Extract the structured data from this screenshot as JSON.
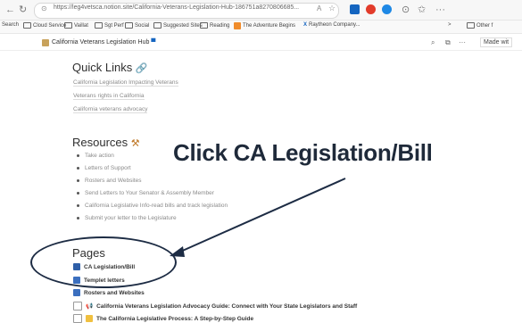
{
  "browser": {
    "url": "https://leg4vetsca.notion.site/California-Veterans-Legislation-Hub-186751a8270806685...",
    "bookmarks": [
      "Search",
      "Cloud Service",
      "Vaillat",
      "Sgt Perf",
      "Social",
      "Suggested Sites",
      "Reading",
      "The Adventure Begins",
      "Raytheon Company...",
      "Other f"
    ],
    "made_with": "Made wit"
  },
  "tab": {
    "title": "California Veterans Legislation Hub"
  },
  "quick_links": {
    "heading": "Quick Links",
    "items": [
      "California Legislation Impacting Veterans",
      "Veterans rights in California",
      "California veterans advocacy"
    ]
  },
  "resources": {
    "heading": "Resources",
    "items": [
      "Take action",
      "Letters of Support",
      "Rosters and Websites",
      "Send Letters to Your Senator & Assembly Member",
      "California Legislative Info-read bills and track legislation",
      "Submit your letter to the Legislature"
    ]
  },
  "annotation": {
    "text": "Click CA Legislation/Bill"
  },
  "pages": {
    "heading": "Pages",
    "items": [
      "CA Legislation/Bill",
      "Templet letters",
      "Rosters and Websites",
      "California Veterans Legislation Advocacy Guide: Connect with Your State Legislators and Staff",
      "The California Legislative Process: A Step-by-Step Guide"
    ]
  },
  "colors": {
    "annotation": "#1f2a3a",
    "ellipse": "#1d2c44"
  }
}
